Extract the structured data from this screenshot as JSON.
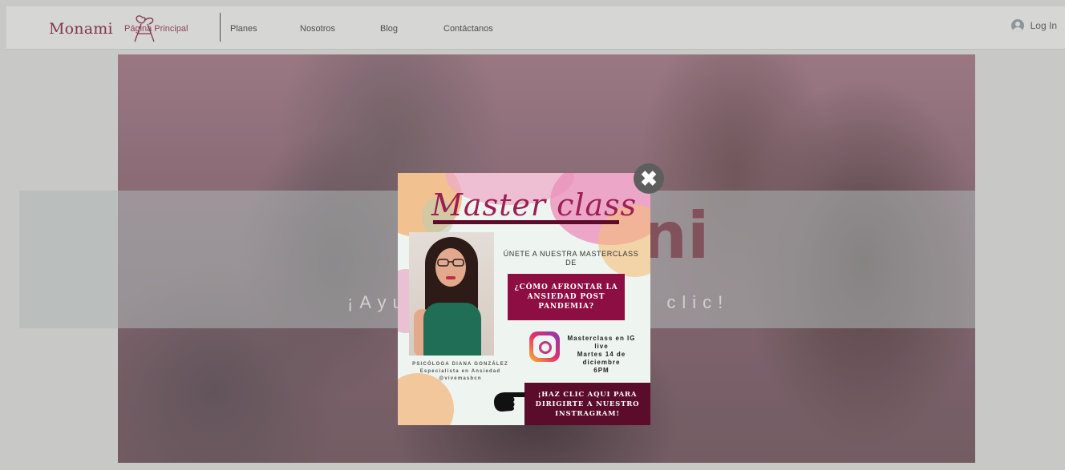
{
  "header": {
    "brand": "Monami",
    "nav": [
      "Página Principal",
      "Planes",
      "Nosotros",
      "Blog",
      "Contáctanos"
    ],
    "login_label": "Log In"
  },
  "hero": {
    "title_fragment": "ni",
    "tagline_left": "¡Ayu",
    "tagline_right": "n clic!"
  },
  "popup": {
    "heading": "Master class",
    "intro": "ÚNETE A NUESTRA MASTERCLASS DE",
    "question": "¿CÓMO AFRONTAR LA ANSIEDAD POST PANDEMIA?",
    "ig_lines": [
      "Masterclass en IG live",
      "Martes 14 de diciembre",
      "6PM"
    ],
    "author_name": "PSICÓLOGA DIANA GONZÁLEZ",
    "author_role": "Especialista en Ansiedad",
    "author_handle": "@vivemasbcn",
    "cta": "¡HAZ CLIC AQUI PARA DIRIGIRTE A NUESTRO INSTRAGRAM!",
    "close_symbol": "✖"
  },
  "colors": {
    "brand": "#8c3a52",
    "question_bg": "#8d0e43",
    "cta_bg": "#5c0c2b"
  },
  "icons": [
    "logo-mark-icon",
    "user-avatar-icon",
    "close-icon",
    "instagram-icon",
    "pointing-hand-icon"
  ]
}
